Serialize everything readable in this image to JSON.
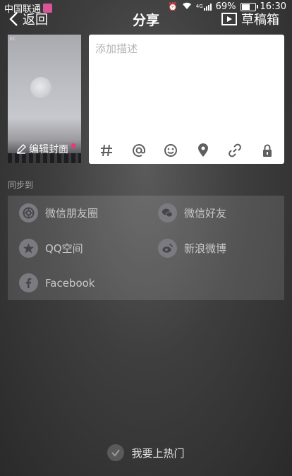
{
  "status_bar": {
    "carrier": "中国联通",
    "network": "4G",
    "battery": "69%",
    "time": "16:30"
  },
  "nav": {
    "back_label": "返回",
    "title": "分享",
    "drafts_label": "草稿箱"
  },
  "cover": {
    "edit_label": "编辑封面"
  },
  "description": {
    "placeholder": "添加描述",
    "tools": [
      "#",
      "@",
      "emoji",
      "location",
      "link",
      "lock"
    ]
  },
  "share": {
    "sync_label": "同步到",
    "targets": [
      {
        "label": "微信朋友圈",
        "icon": "wechat-moments-icon"
      },
      {
        "label": "微信好友",
        "icon": "wechat-icon"
      },
      {
        "label": "QQ空间",
        "icon": "qzone-icon"
      },
      {
        "label": "新浪微博",
        "icon": "weibo-icon"
      },
      {
        "label": "Facebook",
        "icon": "facebook-icon"
      }
    ]
  },
  "bottom": {
    "hot_label": "我要上热门"
  }
}
